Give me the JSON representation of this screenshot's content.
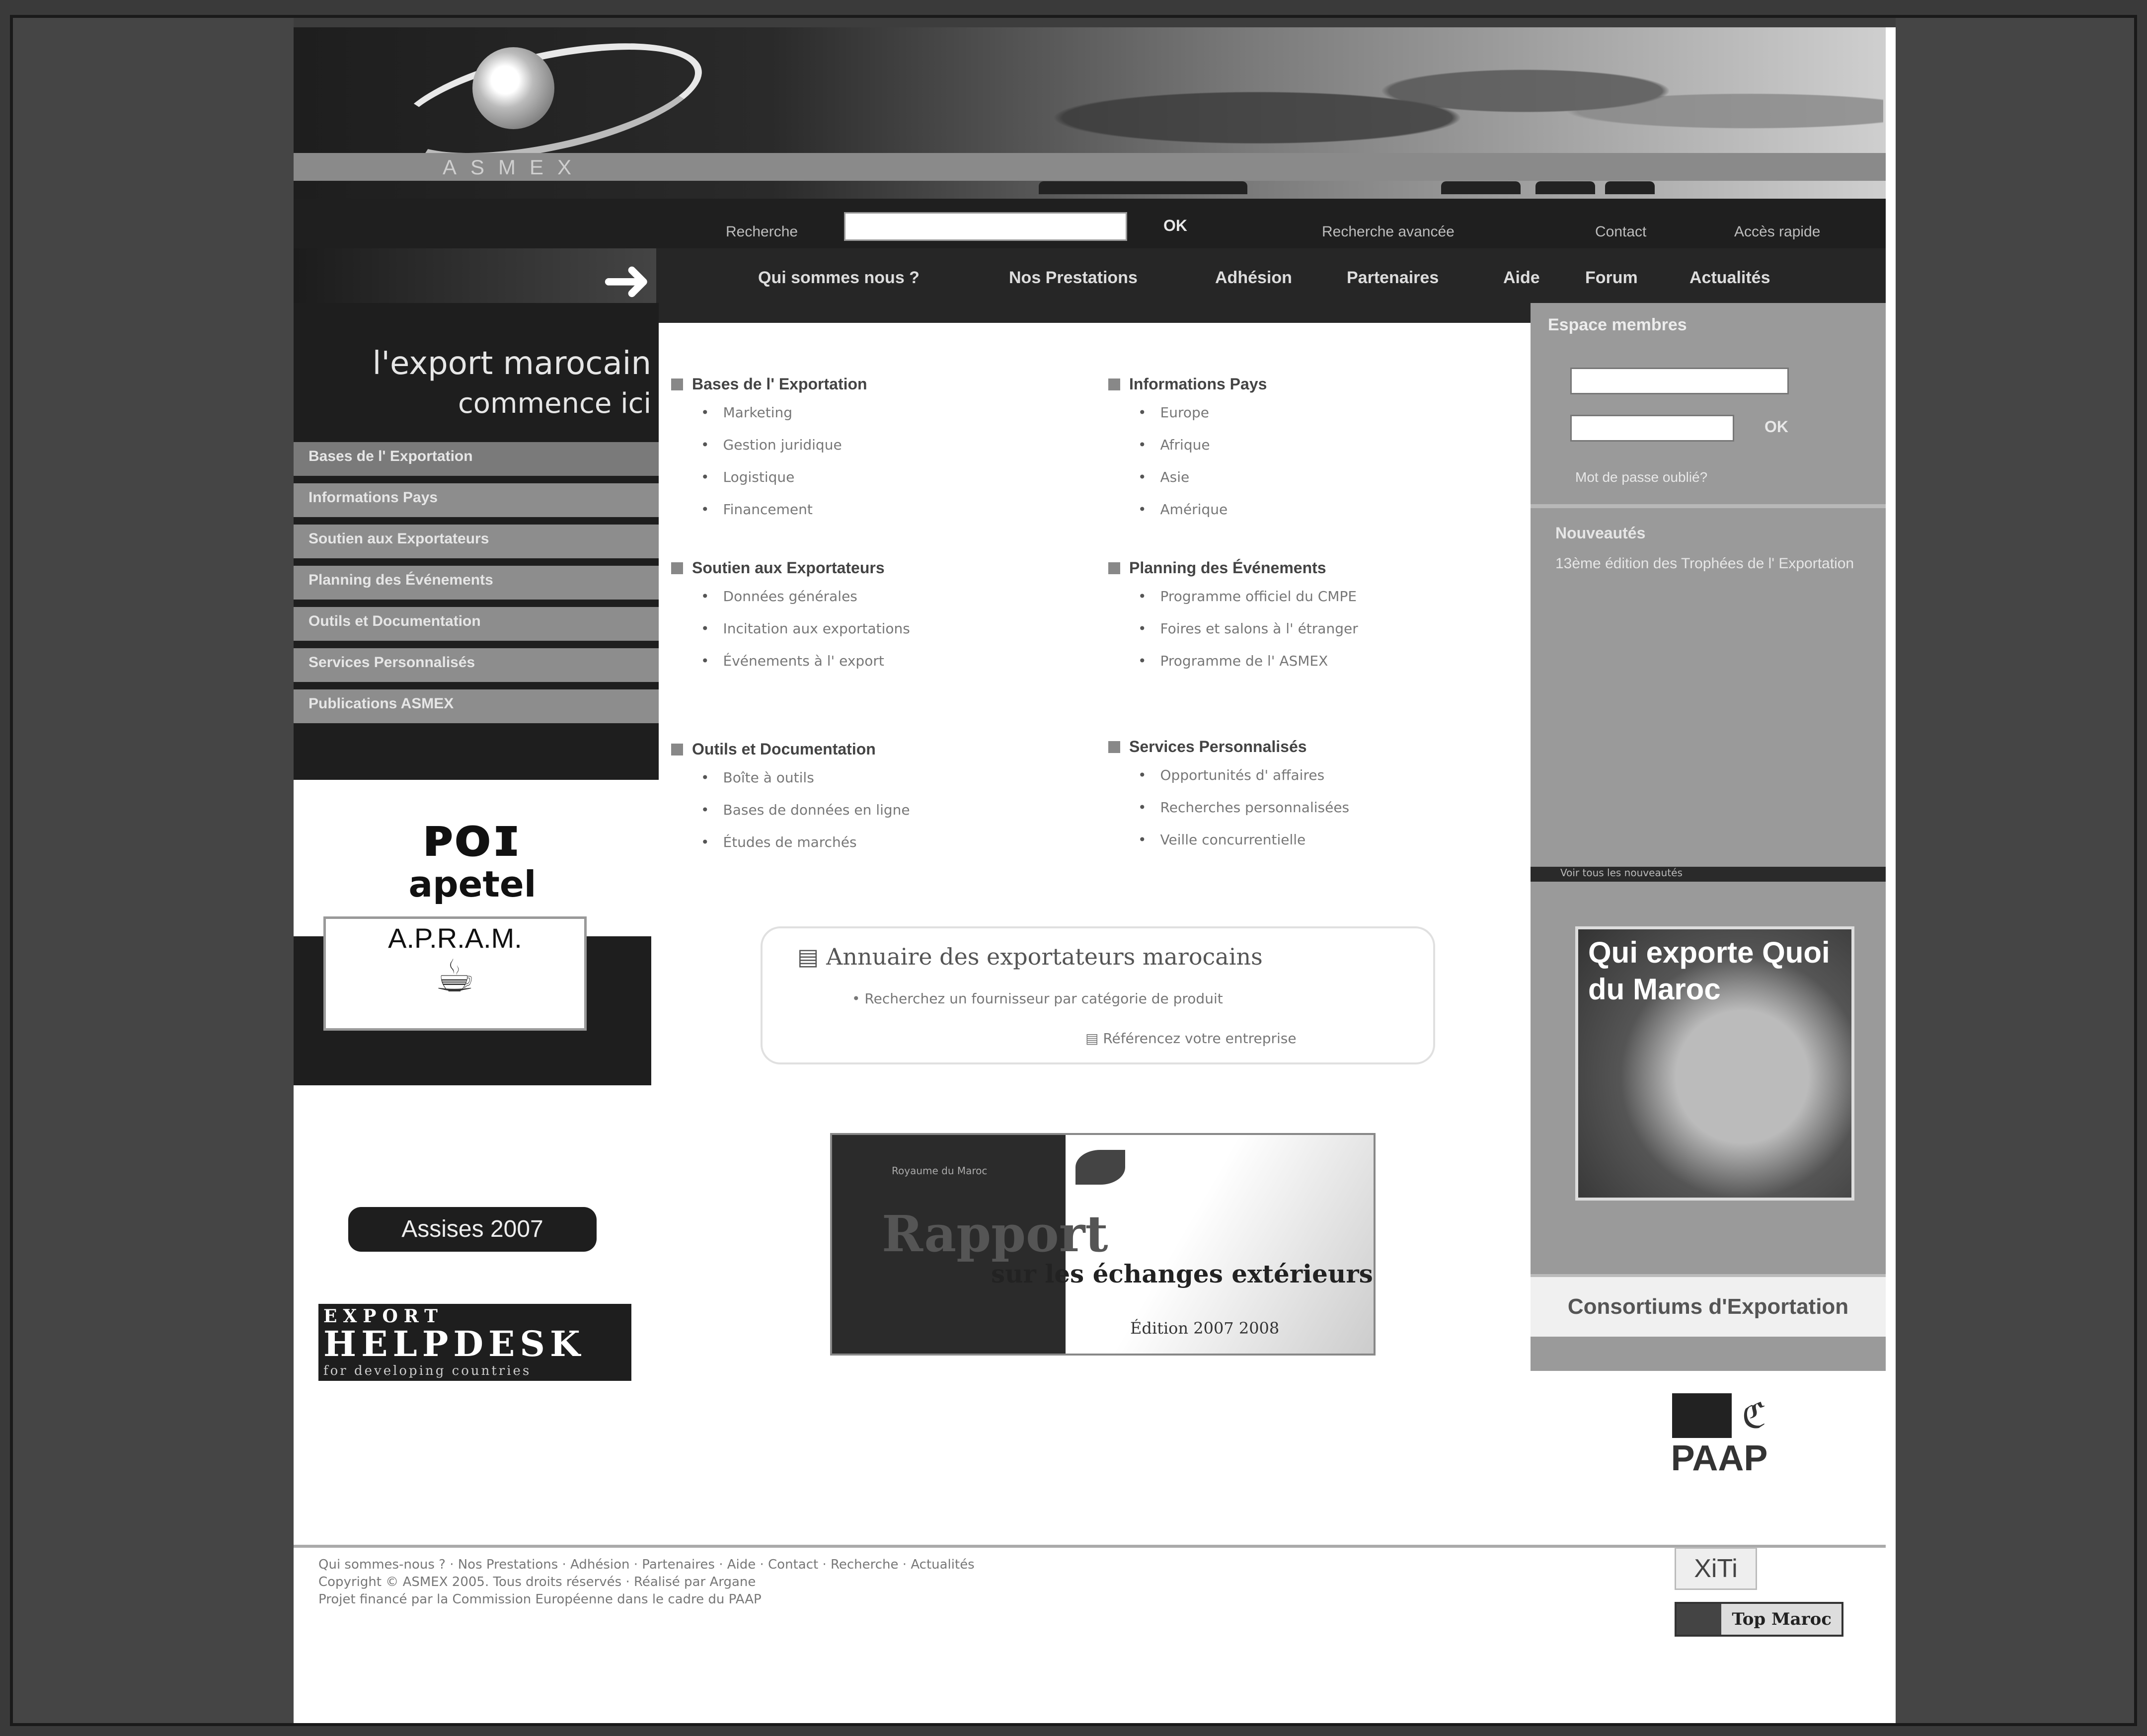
{
  "header": {
    "brand": "ASMEX"
  },
  "topbar": {
    "search_label": "Recherche",
    "search_value": "",
    "ok_label": "OK",
    "advanced_search": "Recherche avancée",
    "contact": "Contact",
    "quick_access": "Accès rapide"
  },
  "nav": {
    "items": [
      "Qui sommes nous ?",
      "Nos Prestations",
      "Adhésion",
      "Partenaires",
      "Aide",
      "Forum",
      "Actualités"
    ]
  },
  "tagline": {
    "line1": "l'export marocain",
    "line2": "commence ici"
  },
  "leftmenu": {
    "items": [
      "Bases de l' Exportation",
      "Informations Pays",
      "Soutien aux Exportateurs",
      "Planning des Événements",
      "Outils et Documentation",
      "Services Personnalisés",
      "Publications ASMEX"
    ]
  },
  "partners": {
    "apetel_mark": "ᴘᴏɪ",
    "apetel": "apetel",
    "apram": "A.P.R.A.M.",
    "assises": "Assises 2007",
    "helpdesk_top": "EXPORT",
    "helpdesk_main": "HELPDESK",
    "helpdesk_sub": "for developing countries"
  },
  "sections": [
    {
      "title": "Bases de l' Exportation",
      "items": [
        "Marketing",
        "Gestion juridique",
        "Logistique",
        "Financement"
      ]
    },
    {
      "title": "Informations Pays",
      "items": [
        "Europe",
        "Afrique",
        "Asie",
        "Amérique"
      ]
    },
    {
      "title": "Soutien aux Exportateurs",
      "items": [
        "Données générales",
        "Incitation aux exportations",
        "Événements à l' export"
      ]
    },
    {
      "title": "Planning des Événements",
      "items": [
        "Programme officiel du CMPE",
        "Foires et salons à l' étranger",
        "Programme de l' ASMEX"
      ]
    },
    {
      "title": "Outils et Documentation",
      "items": [
        "Boîte à outils",
        "Bases de données en ligne",
        "Études de marchés"
      ]
    },
    {
      "title": "Services Personnalisés",
      "items": [
        "Opportunités d' affaires",
        "Recherches personnalisées",
        "Veille concurrentielle"
      ]
    }
  ],
  "annuaire": {
    "title": "Annuaire des exportateurs marocains",
    "link": "Recherchez un fournisseur par catégorie de produit",
    "ref": "Référencez votre entreprise"
  },
  "rapport": {
    "small": "Royaume du Maroc",
    "big": "Rapport",
    "sub": "sur les échanges extérieurs",
    "edition": "Édition 2007 2008"
  },
  "rightcol": {
    "espace_title": "Espace membres",
    "ok_label": "OK",
    "forgot": "Mot de passe oublié?",
    "nouveautes_title": "Nouveautés",
    "nouveautes_text": "13ème édition des Trophées de l' Exportation",
    "dark_bar": "Voir tous les nouveautés",
    "qui_exporte": "Qui exporte Quoi du Maroc",
    "consortiums": "Consortiums d'Exportation",
    "paap": "PAAP"
  },
  "footer": {
    "line1": "Qui sommes-nous ? · Nos Prestations · Adhésion · Partenaires · Aide · Contact · Recherche · Actualités",
    "line2": "Copyright © ASMEX 2005. Tous droits réservés · Réalisé par Argane",
    "line3": "Projet financé par la Commission Européenne dans le cadre du PAAP",
    "xiti": "XiTi",
    "topmaroc": "Top Maroc"
  }
}
